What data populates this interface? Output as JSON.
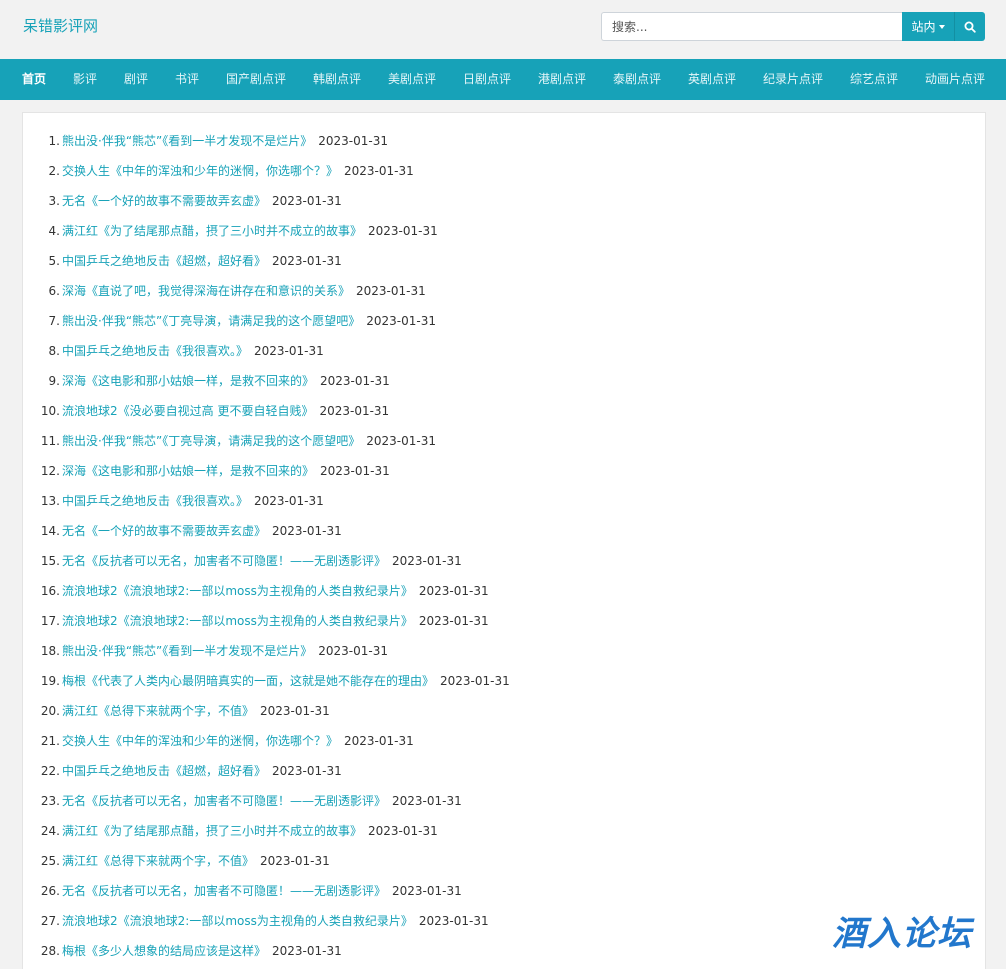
{
  "header": {
    "site_title": "呆错影评网",
    "search_placeholder": "搜索...",
    "scope_label": "站内"
  },
  "nav": [
    {
      "label": "首页",
      "active": true
    },
    {
      "label": "影评"
    },
    {
      "label": "剧评"
    },
    {
      "label": "书评"
    },
    {
      "label": "国产剧点评"
    },
    {
      "label": "韩剧点评"
    },
    {
      "label": "美剧点评"
    },
    {
      "label": "日剧点评"
    },
    {
      "label": "港剧点评"
    },
    {
      "label": "泰剧点评"
    },
    {
      "label": "英剧点评"
    },
    {
      "label": "纪录片点评"
    },
    {
      "label": "综艺点评"
    },
    {
      "label": "动画片点评"
    }
  ],
  "list": [
    {
      "num": "1.",
      "title": "熊出没·伴我“熊芯”《看到一半才发现不是烂片》",
      "date": "2023-01-31"
    },
    {
      "num": "2.",
      "title": "交换人生《中年的浑浊和少年的迷惘，你选哪个？》",
      "date": "2023-01-31"
    },
    {
      "num": "3.",
      "title": "无名《一个好的故事不需要故弄玄虚》",
      "date": "2023-01-31"
    },
    {
      "num": "4.",
      "title": "满江红《为了结尾那点醋，摂了三小时并不成立的故事》",
      "date": "2023-01-31"
    },
    {
      "num": "5.",
      "title": "中国乒乓之绝地反击《超燃，超好看》",
      "date": "2023-01-31"
    },
    {
      "num": "6.",
      "title": "深海《直说了吧，我觉得深海在讲存在和意识的关系》",
      "date": "2023-01-31"
    },
    {
      "num": "7.",
      "title": "熊出没·伴我“熊芯”《丁亮导演，请满足我的这个愿望吧》",
      "date": "2023-01-31"
    },
    {
      "num": "8.",
      "title": "中国乒乓之绝地反击《我很喜欢。》",
      "date": "2023-01-31"
    },
    {
      "num": "9.",
      "title": "深海《这电影和那小姑娘一样，是救不回来的》",
      "date": "2023-01-31"
    },
    {
      "num": "10.",
      "title": "流浪地球2《没必要自视过高 更不要自轻自贱》",
      "date": "2023-01-31"
    },
    {
      "num": "11.",
      "title": "熊出没·伴我“熊芯”《丁亮导演，请满足我的这个愿望吧》",
      "date": "2023-01-31"
    },
    {
      "num": "12.",
      "title": "深海《这电影和那小姑娘一样，是救不回来的》",
      "date": "2023-01-31"
    },
    {
      "num": "13.",
      "title": "中国乒乓之绝地反击《我很喜欢。》",
      "date": "2023-01-31"
    },
    {
      "num": "14.",
      "title": "无名《一个好的故事不需要故弄玄虚》",
      "date": "2023-01-31"
    },
    {
      "num": "15.",
      "title": "无名《反抗者可以无名，加害者不可隐匿！——无剧透影评》",
      "date": "2023-01-31"
    },
    {
      "num": "16.",
      "title": "流浪地球2《流浪地球2:一部以moss为主视角的人类自救纪录片》",
      "date": "2023-01-31"
    },
    {
      "num": "17.",
      "title": "流浪地球2《流浪地球2:一部以moss为主视角的人类自救纪录片》",
      "date": "2023-01-31"
    },
    {
      "num": "18.",
      "title": "熊出没·伴我“熊芯”《看到一半才发现不是烂片》",
      "date": "2023-01-31"
    },
    {
      "num": "19.",
      "title": "梅根《代表了人类内心最阴暗真实的一面，这就是她不能存在的理由》",
      "date": "2023-01-31"
    },
    {
      "num": "20.",
      "title": "满江红《总得下来就两个字，不值》",
      "date": "2023-01-31"
    },
    {
      "num": "21.",
      "title": "交换人生《中年的浑浊和少年的迷惘，你选哪个？》",
      "date": "2023-01-31"
    },
    {
      "num": "22.",
      "title": "中国乒乓之绝地反击《超燃，超好看》",
      "date": "2023-01-31"
    },
    {
      "num": "23.",
      "title": "无名《反抗者可以无名，加害者不可隐匿！——无剧透影评》",
      "date": "2023-01-31"
    },
    {
      "num": "24.",
      "title": "满江红《为了结尾那点醋，摂了三小时并不成立的故事》",
      "date": "2023-01-31"
    },
    {
      "num": "25.",
      "title": "满江红《总得下来就两个字，不值》",
      "date": "2023-01-31"
    },
    {
      "num": "26.",
      "title": "无名《反抗者可以无名，加害者不可隐匿！——无剧透影评》",
      "date": "2023-01-31"
    },
    {
      "num": "27.",
      "title": "流浪地球2《流浪地球2:一部以moss为主视角的人类自救纪录片》",
      "date": "2023-01-31"
    },
    {
      "num": "28.",
      "title": "梅根《多少人想象的结局应该是这样》",
      "date": "2023-01-31"
    }
  ],
  "watermark": "酒入论坛",
  "colors": {
    "accent": "#17a2b8",
    "page_bg": "#f2f2f2"
  }
}
